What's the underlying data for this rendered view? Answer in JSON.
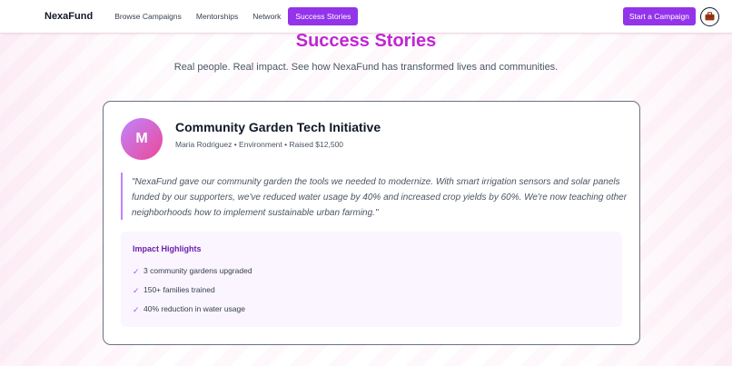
{
  "header": {
    "brand": "NexaFund",
    "nav": [
      {
        "label": "Browse Campaigns"
      },
      {
        "label": "Mentorships"
      },
      {
        "label": "Network"
      },
      {
        "label": "Success Stories"
      }
    ],
    "cta_label": "Start a Campaign",
    "account_icon": "briefcase-icon"
  },
  "hero": {
    "title": "Success Stories",
    "subtitle": "Real people. Real impact. See how NexaFund has transformed lives and communities."
  },
  "story": {
    "avatar_initial": "M",
    "title": "Community Garden Tech Initiative",
    "meta": "Maria Rodriguez • Environment • Raised $12,500",
    "quote": "\"NexaFund gave our community garden the tools we needed to modernize. With smart irrigation sensors and solar panels funded by our supporters, we've reduced water usage by 40% and increased crop yields by 60%. We're now teaching other neighborhoods how to implement sustainable urban farming.\"",
    "impact_title": "Impact Highlights",
    "impact_items": [
      {
        "check": "✓",
        "text": "3 community gardens upgraded"
      },
      {
        "check": "✓",
        "text": "150+ families trained"
      },
      {
        "check": "✓",
        "text": "40% reduction in water usage"
      }
    ]
  },
  "colors": {
    "accent": "#9333ea",
    "title": "#c026d3",
    "avatar_gradient_start": "#c084fc",
    "avatar_gradient_end": "#ec4899"
  }
}
